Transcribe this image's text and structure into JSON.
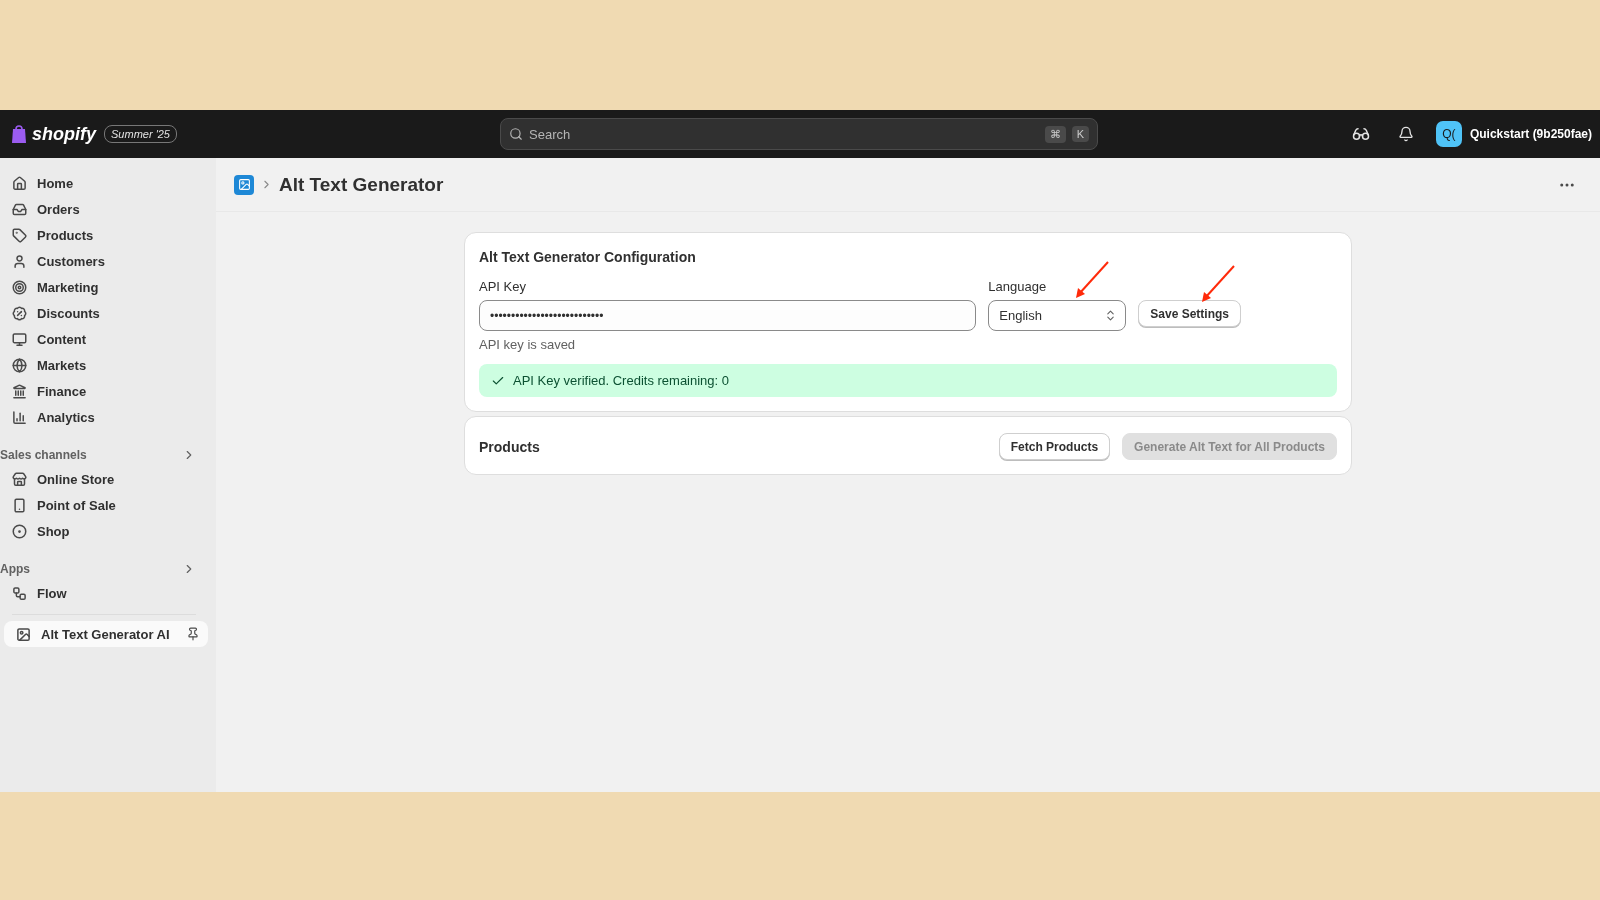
{
  "topbar": {
    "logo": "shopify",
    "edition_badge": "Summer '25",
    "search": {
      "placeholder": "Search",
      "shortcut_keys": [
        "⌘",
        "K"
      ]
    },
    "avatar_initials": "Q(",
    "store_name": "Quickstart (9b250fae)"
  },
  "sidebar": {
    "main_items": [
      {
        "label": "Home",
        "selected": false
      },
      {
        "label": "Orders",
        "selected": false
      },
      {
        "label": "Products",
        "selected": false
      },
      {
        "label": "Customers",
        "selected": false
      },
      {
        "label": "Marketing",
        "selected": false
      },
      {
        "label": "Discounts",
        "selected": false
      },
      {
        "label": "Content",
        "selected": false
      },
      {
        "label": "Markets",
        "selected": false
      },
      {
        "label": "Finance",
        "selected": false
      },
      {
        "label": "Analytics",
        "selected": false
      }
    ],
    "sections": [
      {
        "title": "Sales channels",
        "items": [
          {
            "label": "Online Store",
            "selected": false
          },
          {
            "label": "Point of Sale",
            "selected": false
          },
          {
            "label": "Shop",
            "selected": false
          }
        ]
      },
      {
        "title": "Apps",
        "items": [
          {
            "label": "Flow",
            "selected": false
          }
        ]
      }
    ],
    "app_item": {
      "label": "Alt Text Generator AI",
      "selected": true,
      "pinned": true
    }
  },
  "page": {
    "title": "Alt Text Generator",
    "config_card": {
      "title": "Alt Text Generator Configuration",
      "api_key_label": "API Key",
      "api_key_value": "•••••••••••••••••••••••••••",
      "api_key_help": "API key is saved",
      "language_label": "Language",
      "language_value": "English",
      "save_button": "Save Settings",
      "banner": "API Key verified. Credits remaining: 0"
    },
    "products_card": {
      "title": "Products",
      "buttons": [
        {
          "label": "Fetch Products",
          "disabled": false
        },
        {
          "label": "Generate Alt Text for All Products",
          "disabled": true
        }
      ]
    }
  }
}
